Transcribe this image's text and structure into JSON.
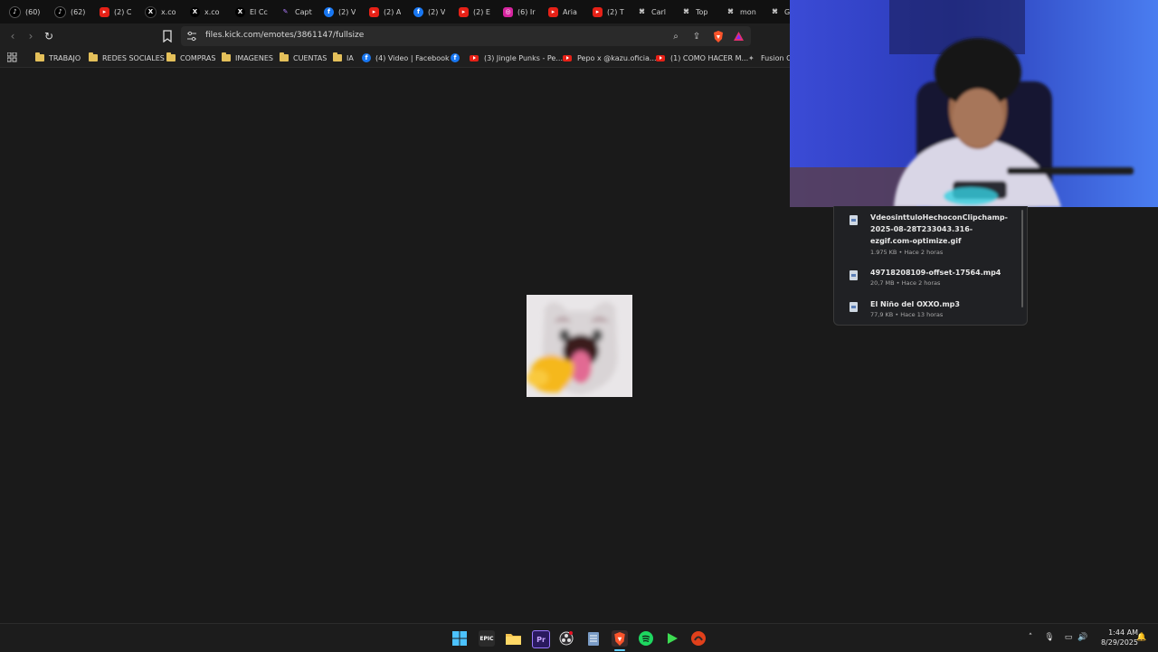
{
  "browser": {
    "tabs": [
      {
        "label": "(60)",
        "icon": "tiktok-icon"
      },
      {
        "label": "(62)",
        "icon": "tiktok-icon"
      },
      {
        "label": "(2) C",
        "icon": "youtube-icon"
      },
      {
        "label": "x.co",
        "icon": "x-icon"
      },
      {
        "label": "x.co",
        "icon": "x-icon"
      },
      {
        "label": "El Cc",
        "icon": "x-icon"
      },
      {
        "label": "Capt",
        "icon": "feather-icon"
      },
      {
        "label": "(2) V",
        "icon": "facebook-icon"
      },
      {
        "label": "(2) A",
        "icon": "youtube-icon"
      },
      {
        "label": "(2) V",
        "icon": "facebook-icon"
      },
      {
        "label": "(2) E",
        "icon": "youtube-icon"
      },
      {
        "label": "(6) Ir",
        "icon": "instagram-icon"
      },
      {
        "label": "Aria",
        "icon": "youtube-icon"
      },
      {
        "label": "(2) T",
        "icon": "youtube-icon"
      },
      {
        "label": "Carl",
        "icon": "kick-icon"
      },
      {
        "label": "Top",
        "icon": "kick-icon"
      },
      {
        "label": "mon",
        "icon": "kick-icon"
      },
      {
        "label": "G",
        "icon": "kick-icon"
      }
    ],
    "url": "files.kick.com/emotes/3861147/fullsize",
    "bookmarks": [
      {
        "label": "TRABAJO",
        "type": "folder"
      },
      {
        "label": "REDES SOCIALES",
        "type": "folder"
      },
      {
        "label": "COMPRAS",
        "type": "folder"
      },
      {
        "label": "IMAGENES",
        "type": "folder"
      },
      {
        "label": "CUENTAS",
        "type": "folder"
      },
      {
        "label": "IA",
        "type": "folder"
      },
      {
        "label": "(4) Video | Facebook",
        "type": "facebook"
      },
      {
        "label": "",
        "type": "facebook"
      },
      {
        "label": "(3) Jingle Punks - Pe...",
        "type": "youtube"
      },
      {
        "label": "Pepo x @kazu.oficia...",
        "type": "youtube"
      },
      {
        "label": "(1) COMO HACER M...",
        "type": "youtube"
      },
      {
        "label": "Fusion Cl",
        "type": "site"
      }
    ]
  },
  "downloads": {
    "items": [
      {
        "name": "VdeosinttuloHechoconClipchamp-2025-08-28T233043.316-ezgif.com-optimize.gif",
        "meta": "1.975 KB • Hace 2 horas"
      },
      {
        "name": "49718208109-offset-17564.mp4",
        "meta": "20,7 MB • Hace 2 horas"
      },
      {
        "name": "El Niño del OXXO.mp3",
        "meta": "77,9 KB • Hace 13 horas"
      }
    ]
  },
  "taskbar": {
    "apps": [
      "start",
      "epic-games",
      "file-explorer",
      "premiere-pro",
      "obs",
      "notepad",
      "brave",
      "spotify",
      "media-app",
      "game-app"
    ],
    "time": "1:44 AM",
    "date": "8/29/2025"
  },
  "colors": {
    "kick_green": "#53fc18",
    "youtube_red": "#e62117",
    "facebook_blue": "#1877f2",
    "folder_yellow": "#e4c05a"
  }
}
